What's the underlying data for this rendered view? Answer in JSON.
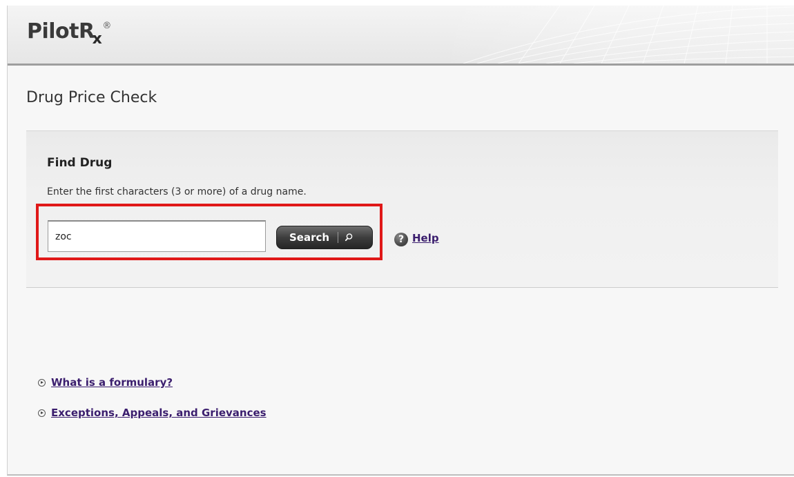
{
  "header": {
    "logo_text": "PilotR",
    "logo_x": "x",
    "logo_reg": "®"
  },
  "page": {
    "title": "Drug Price Check"
  },
  "find_drug": {
    "title": "Find Drug",
    "instructions": "Enter the first characters (3 or more) of a drug name.",
    "input_value": "zoc",
    "search_label": "Search",
    "search_icon": "magnifier-icon",
    "help_icon": "question-icon",
    "help_label": "Help",
    "highlight_color": "#e01818"
  },
  "links": [
    {
      "label": "What is a formulary?",
      "icon": "circle-arrow-icon"
    },
    {
      "label": "Exceptions, Appeals, and Grievances",
      "icon": "circle-arrow-icon"
    }
  ],
  "colors": {
    "link": "#3b1e6e",
    "button": "#3d3d3d"
  }
}
